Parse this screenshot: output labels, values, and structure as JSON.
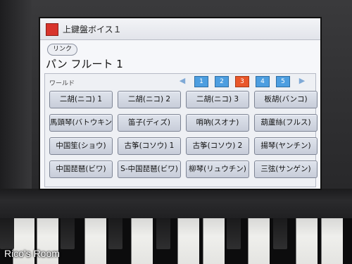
{
  "window": {
    "title": "上鍵盤ボイス１"
  },
  "link_button": {
    "label": "リンク"
  },
  "voice": {
    "name": "パン フルート 1"
  },
  "category": {
    "label": "ワールド"
  },
  "pager": {
    "prev_icon": "triangle-left-icon",
    "next_icon": "triangle-right-icon",
    "pages": [
      "1",
      "2",
      "3",
      "4",
      "5"
    ],
    "active_page": "3"
  },
  "voices": [
    [
      "二胡(ニコ) 1",
      "二胡(ニコ) 2",
      "二胡(ニコ) 3",
      "板胡(バンコ)"
    ],
    [
      "馬頭琴(バトウキン)",
      "笛子(ディズ)",
      "哨吶(スオナ)",
      "葫蘆絲(フルス)"
    ],
    [
      "中国笙(ショウ)",
      "古筝(コソウ) 1",
      "古筝(コソウ) 2",
      "揚琴(ヤンチン)"
    ],
    [
      "中国琵琶(ビワ)",
      "S-中国琵琶(ビワ)",
      "柳琴(リュウチン)",
      "三弦(サンゲン)"
    ]
  ],
  "colors": {
    "title_square": "#d8342c",
    "page_button": "#4d9ee0",
    "active_page_button": "#e9572a"
  },
  "watermark": "Rico's Room"
}
